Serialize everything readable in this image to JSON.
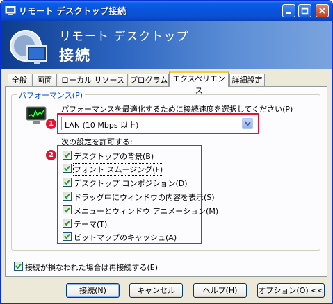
{
  "window": {
    "title": "リモート デスクトップ接続"
  },
  "banner": {
    "line1": "リモート デスクトップ",
    "line2": "接続"
  },
  "tabs": [
    {
      "label": "全般"
    },
    {
      "label": "画面"
    },
    {
      "label": "ローカル リソース"
    },
    {
      "label": "プログラム"
    },
    {
      "label": "エクスペリエンス",
      "active": true
    },
    {
      "label": "詳細設定"
    }
  ],
  "performance": {
    "group_label": "パフォーマンス(P)",
    "prompt": "パフォーマンスを最適化するために接続速度を選択してください(P)",
    "connection_speed": "LAN (10 Mbps 以上)",
    "allow_label": "次の設定を許可する:",
    "options": [
      {
        "label": "デスクトップの背景(B)",
        "checked": true
      },
      {
        "label": "フォント スムージング(F)",
        "checked": true
      },
      {
        "label": "デスクトップ コンポジション(D)",
        "checked": true
      },
      {
        "label": "ドラッグ中にウィンドウの内容を表示(S)",
        "checked": true
      },
      {
        "label": "メニューとウィンドウ アニメーション(M)",
        "checked": true
      },
      {
        "label": "テーマ(T)",
        "checked": true
      },
      {
        "label": "ビットマップのキャッシュ(A)",
        "checked": true
      }
    ]
  },
  "annotations": {
    "badge1": "1",
    "badge2": "2"
  },
  "reconnect": {
    "label": "接続が損なわれた場合は再接続する(E)",
    "checked": true
  },
  "buttons": {
    "connect": "接続(N)",
    "cancel": "キャンセル",
    "help": "ヘルプ(H)",
    "options": "オプション(O) <<"
  },
  "colors": {
    "titlebar": "#0855dd",
    "highlight": "#e0142e",
    "group_label": "#0046d5"
  }
}
